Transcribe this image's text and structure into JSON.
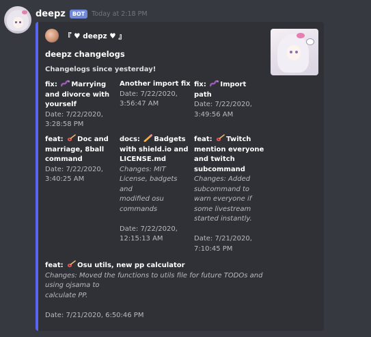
{
  "message": {
    "username": "deepz",
    "bot_badge": "BOT",
    "timestamp": "Today at 2:18 PM"
  },
  "embed": {
    "border_color": "#5865f2",
    "author_name": "『 ♥ deepz ♥ 』",
    "title": "deepz changelogs",
    "description": "Changelogs since yesterday!",
    "fields": [
      {
        "prefix": "fix:",
        "emoji": "worm",
        "title_lines": [
          "Marrying",
          "and divorce with",
          "yourself"
        ],
        "changes": [],
        "date_lines": [
          "Date: 7/22/2020,",
          "3:28:58 PM"
        ]
      },
      {
        "prefix": "",
        "emoji": "",
        "title_lines": [
          "Another import fix"
        ],
        "changes": [],
        "date_lines": [
          "Date: 7/22/2020,",
          "3:56:47 AM"
        ]
      },
      {
        "prefix": "fix:",
        "emoji": "worm",
        "title_lines": [
          "Import path"
        ],
        "changes": [],
        "date_lines": [
          "Date: 7/22/2020,",
          "3:49:56 AM"
        ]
      },
      {
        "prefix": "feat:",
        "emoji": "guitar",
        "title_lines": [
          "Doc and",
          "marriage, 8ball",
          "command"
        ],
        "changes": [],
        "date_lines": [
          "Date: 7/22/2020,",
          "3:40:25 AM"
        ]
      },
      {
        "prefix": "docs:",
        "emoji": "pencil",
        "title_lines": [
          "Badgets",
          "with shield.io and",
          "LICENSE.md"
        ],
        "changes": [
          "Changes: MIT",
          "License, badgets and",
          "modified osu",
          "commands"
        ],
        "date_lines": [
          "Date: 7/22/2020,",
          "12:15:13 AM"
        ]
      },
      {
        "prefix": "feat:",
        "emoji": "guitar",
        "title_lines": [
          "Twitch",
          "mention everyone",
          "and twitch",
          "subcommand"
        ],
        "changes": [
          "Changes: Added",
          "subcommand to",
          "warn everyone if",
          "some livestream",
          "started instantly."
        ],
        "date_lines": [
          "Date: 7/21/2020,",
          "7:10:45 PM"
        ]
      },
      {
        "prefix": "feat:",
        "emoji": "guitar",
        "title_lines": [
          "Osu utils, new pp calculator"
        ],
        "changes": [
          "Changes: Moved the functions to utils file for future TODOs and",
          "using ojsama to",
          "calculate PP."
        ],
        "date_lines": [
          "Date: 7/21/2020, 6:50:46 PM"
        ]
      }
    ]
  }
}
